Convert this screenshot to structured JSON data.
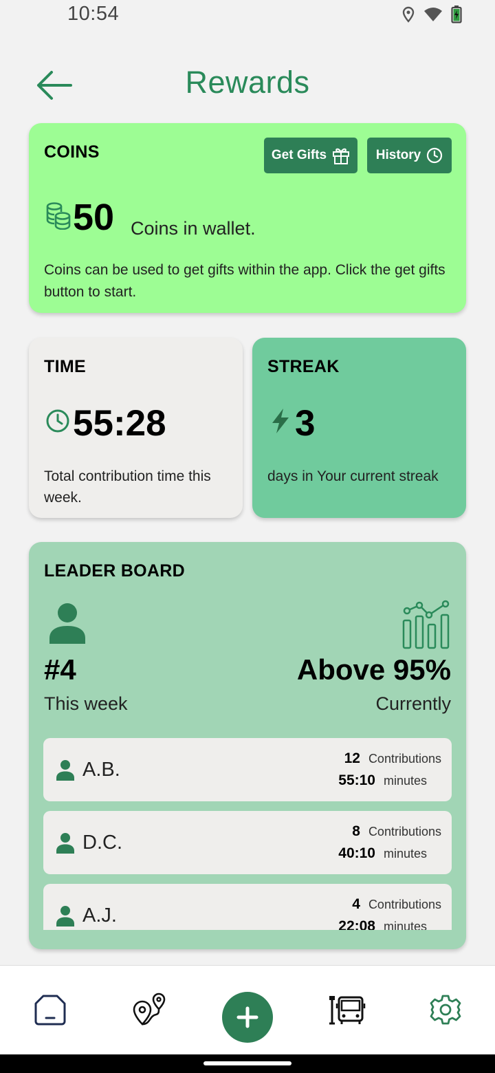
{
  "status_bar": {
    "time": "10:54",
    "icons": [
      "location-icon",
      "wifi-icon",
      "battery-icon"
    ]
  },
  "header": {
    "title": "Rewards",
    "back_icon": "arrow-left-icon"
  },
  "coins_card": {
    "title": "COINS",
    "get_gifts_label": "Get Gifts",
    "history_label": "History",
    "value": "50",
    "value_label": "Coins in wallet.",
    "description": "Coins can be used to get gifts within the app. Click the get gifts button to start."
  },
  "time_card": {
    "title": "TIME",
    "value": "55:28",
    "description": "Total contribution time this week."
  },
  "streak_card": {
    "title": "STREAK",
    "value": "3",
    "description": "days in Your current streak"
  },
  "leader_board": {
    "title": "LEADER BOARD",
    "rank": "#4",
    "rank_label": "This week",
    "percentile": "Above 95%",
    "percentile_label": "Currently",
    "entries": [
      {
        "name": "A.B.",
        "contributions": "12",
        "contributions_label": "Contributions",
        "minutes": "55:10",
        "minutes_label": "minutes"
      },
      {
        "name": "D.C.",
        "contributions": "8",
        "contributions_label": "Contributions",
        "minutes": "40:10",
        "minutes_label": "minutes"
      },
      {
        "name": "A.J.",
        "contributions": "4",
        "contributions_label": "Contributions",
        "minutes": "22:08",
        "minutes_label": "minutes"
      }
    ]
  },
  "bottom_nav": {
    "items": [
      "home-icon",
      "map-route-icon",
      "add-icon",
      "bus-stop-icon",
      "settings-icon"
    ]
  },
  "colors": {
    "primary": "#2e7f56",
    "title_green": "#2a8a5a",
    "coins_bg": "#9dfd94",
    "streak_bg": "#70cb9d",
    "leader_bg": "#a1d5b5",
    "card_grey": "#efeeec"
  }
}
